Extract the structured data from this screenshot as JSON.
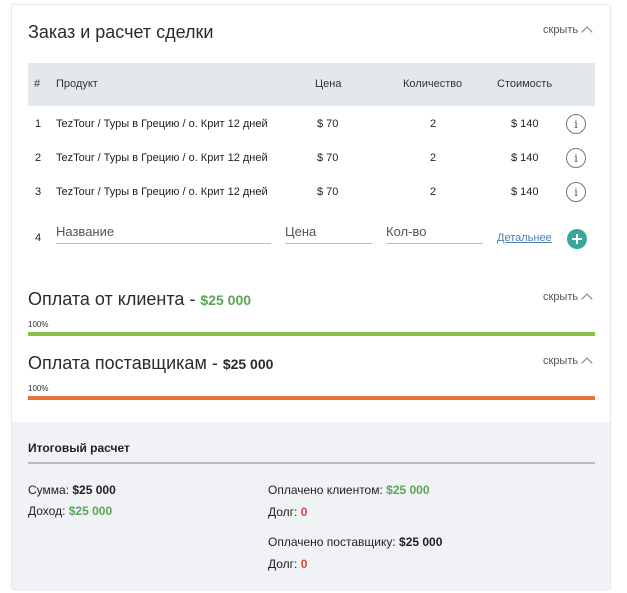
{
  "order": {
    "title": "Заказ и расчет сделки",
    "hide_label": "скрыть",
    "columns": {
      "num": "#",
      "product": "Продукт",
      "price": "Цена",
      "qty": "Количество",
      "cost": "Стоимость"
    },
    "rows": [
      {
        "num": "1",
        "product": "TezTour / Туры в Грецию / о. Крит 12 дней",
        "price": "$ 70",
        "qty": "2",
        "cost": "$ 140"
      },
      {
        "num": "2",
        "product": "TezTour / Туры в Грецию / о. Крит 12 дней",
        "price": "$ 70",
        "qty": "2",
        "cost": "$ 140"
      },
      {
        "num": "3",
        "product": "TezTour / Туры в Грецию / о. Крит 12 дней",
        "price": "$ 70",
        "qty": "2",
        "cost": "$ 140"
      }
    ],
    "info_icon_glyph": "i",
    "new_row": {
      "num": "4",
      "name_placeholder": "Название",
      "price_placeholder": "Цена",
      "qty_placeholder": "Кол-во",
      "details_link": "Детальнее"
    }
  },
  "client_payment": {
    "title": "Оплата от клиента - ",
    "amount": "$25 000",
    "hide_label": "скрыть",
    "progress_label": "100%",
    "progress": 1.0,
    "color": "#8bc34a"
  },
  "supplier_payment": {
    "title": "Оплата поставщикам - ",
    "amount": "$25 000",
    "hide_label": "скрыть",
    "progress_label": "100%",
    "progress": 1.0,
    "color": "#e8733a"
  },
  "summary": {
    "title": "Итоговый расчет",
    "sum_label": "Сумма: ",
    "sum_value": "$25 000",
    "income_label": "Доход: ",
    "income_value": "$25 000",
    "paid_client_label": "Оплачено клиентом: ",
    "paid_client_value": "$25 000",
    "debt_label": "Долг: ",
    "debt_client_value": "0",
    "paid_supplier_label": "Оплачено поставщику: ",
    "paid_supplier_value": "$25 000",
    "debt_supplier_value": "0"
  },
  "colors": {
    "accent_green": "#5aa457",
    "teal": "#3aa79b",
    "debt_red": "#d9463c",
    "link_blue": "#4a7fb5"
  }
}
